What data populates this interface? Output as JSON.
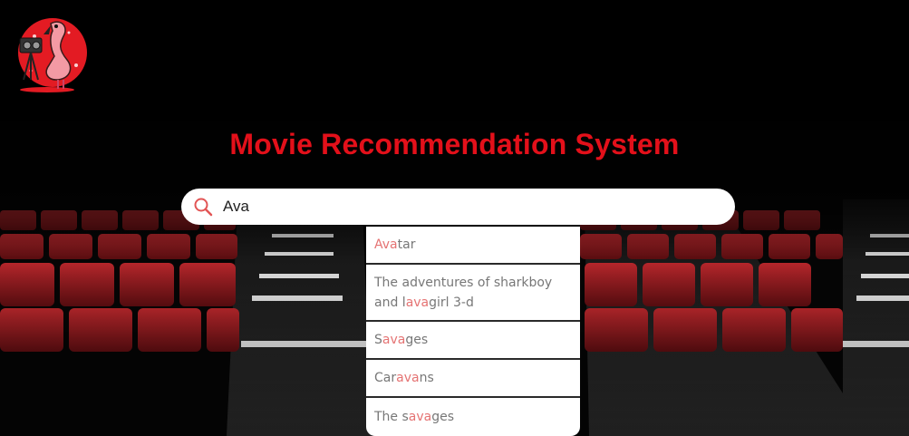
{
  "app": {
    "title": "Movie Recommendation System"
  },
  "search": {
    "value": "Ava",
    "query": "ava"
  },
  "suggestions": [
    {
      "text": "Avatar"
    },
    {
      "text": "The adventures of sharkboy and lavagirl 3-d"
    },
    {
      "text": "Savages"
    },
    {
      "text": "Caravans"
    },
    {
      "text": "The savages"
    }
  ],
  "colors": {
    "accent": "#e3101a",
    "highlight": "#e57373",
    "seat": "#8e1a1e",
    "background": "#000000"
  },
  "icons": {
    "logo": "flamingo-camera-logo",
    "search": "search-icon"
  }
}
